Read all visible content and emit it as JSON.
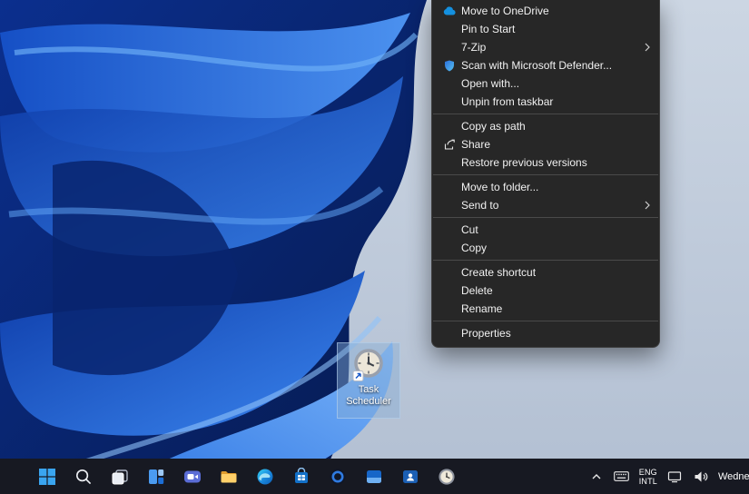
{
  "context_menu": {
    "groups": [
      {
        "items": [
          {
            "label": "Move to OneDrive",
            "icon": "onedrive-icon"
          },
          {
            "label": "Pin to Start"
          },
          {
            "label": "7-Zip",
            "has_submenu": true
          },
          {
            "label": "Scan with Microsoft Defender...",
            "icon": "defender-shield-icon"
          },
          {
            "label": "Open with..."
          },
          {
            "label": "Unpin from taskbar"
          }
        ]
      },
      {
        "items": [
          {
            "label": "Copy as path"
          },
          {
            "label": "Share",
            "icon": "share-icon"
          },
          {
            "label": "Restore previous versions"
          }
        ]
      },
      {
        "items": [
          {
            "label": "Move to folder..."
          },
          {
            "label": "Send to",
            "has_submenu": true
          }
        ]
      },
      {
        "items": [
          {
            "label": "Cut"
          },
          {
            "label": "Copy"
          }
        ]
      },
      {
        "items": [
          {
            "label": "Create shortcut"
          },
          {
            "label": "Delete"
          },
          {
            "label": "Rename"
          }
        ]
      },
      {
        "items": [
          {
            "label": "Properties"
          }
        ]
      }
    ]
  },
  "desktop_icon": {
    "label": "Task Scheduler"
  },
  "taskbar": {
    "app_icons": [
      "start",
      "search",
      "task-view",
      "widgets",
      "chat",
      "file-explorer",
      "edge",
      "microsoft-store",
      "ring-app",
      "blue-window-app",
      "contact-app",
      "task-scheduler"
    ],
    "tray": {
      "language_line1": "ENG",
      "language_line2": "INTL",
      "date": "Wedne",
      "tray_icons": [
        "chevron-up",
        "touch-keyboard",
        "network",
        "volume"
      ]
    }
  },
  "colors": {
    "menu_background": "#272727",
    "menu_text": "#f1f1f1",
    "taskbar_background": "#171922",
    "selection_highlight": "rgba(136,173,212,0.45)",
    "accent_blue": "#3aa5f0",
    "wallpaper_light": "#c3cdda",
    "wallpaper_navy": "#081f5c"
  }
}
